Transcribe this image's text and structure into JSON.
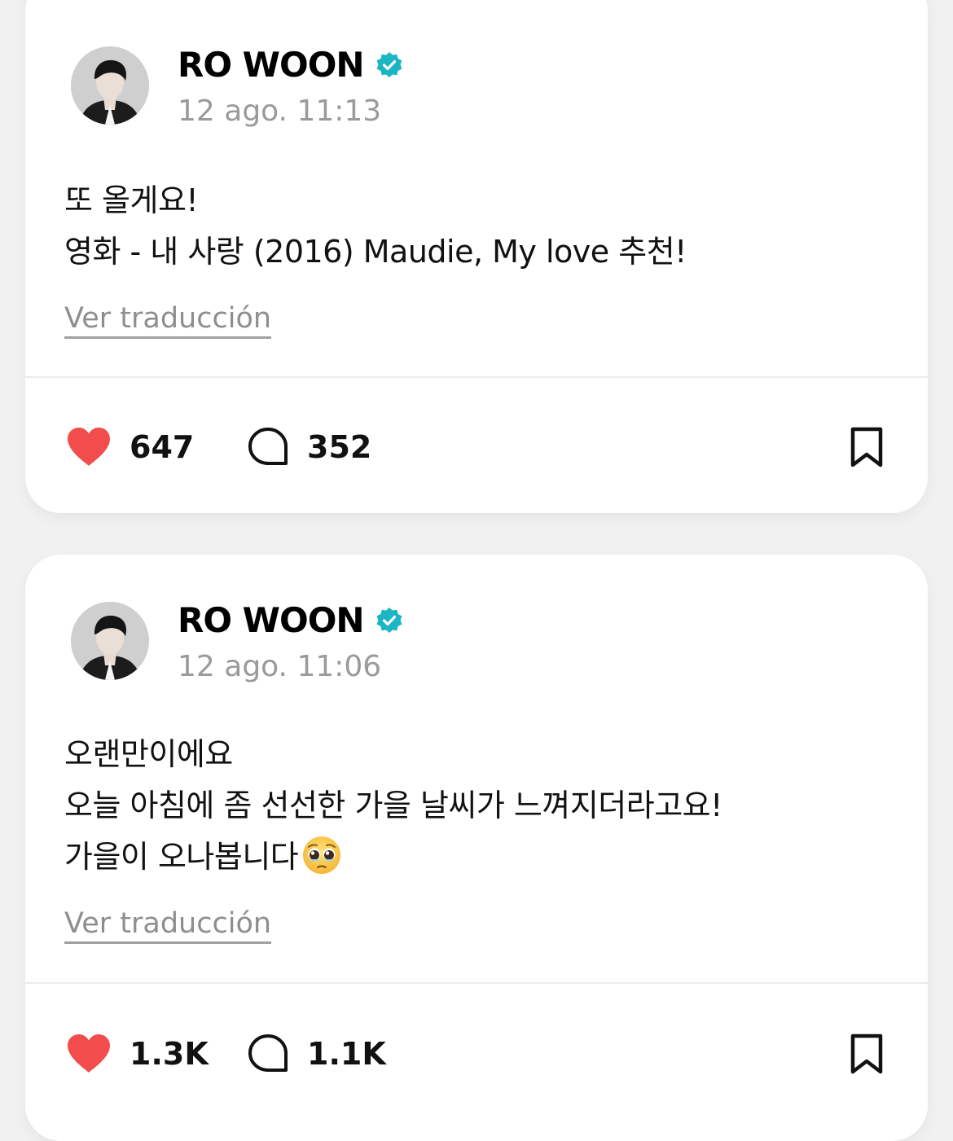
{
  "posts": [
    {
      "author": "RO WOON",
      "timestamp": "12 ago. 11:13",
      "lines": [
        "또 올게요!",
        "영화 - 내 사랑 (2016) Maudie, My love 추천!"
      ],
      "translate_label": "Ver traducción",
      "likes": "647",
      "comments": "352"
    },
    {
      "author": "RO WOON",
      "timestamp": "12 ago. 11:06",
      "lines": [
        "오랜만이에요",
        "오늘 아침에 좀 선선한 가을 날씨가 느껴지더라고요!",
        "가을이 오나봅니다"
      ],
      "emoji": "pleading-face",
      "translate_label": "Ver traducción",
      "likes": "1.3K",
      "comments": "1.1K"
    }
  ],
  "icons": {
    "verified": "verified-badge-icon",
    "like": "heart-icon",
    "comment": "comment-bubble-icon",
    "save": "bookmark-icon"
  },
  "colors": {
    "verified": "#1bb5c4",
    "heart": "#f24c4c",
    "muted_text": "#9a9a9a",
    "card_bg": "#ffffff",
    "page_bg": "#f1f1f1"
  }
}
